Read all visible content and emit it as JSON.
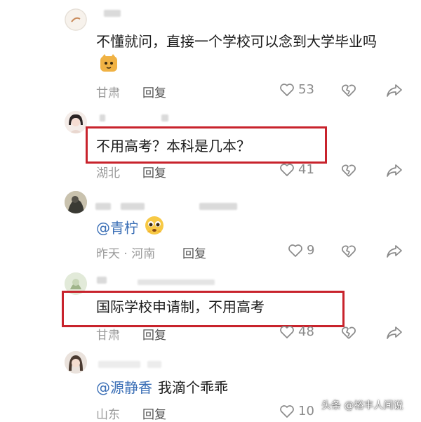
{
  "comments": [
    {
      "text": "不懂就问，直接一个学校可以念到大学毕业吗",
      "location": "甘肃",
      "reply_label": "回复",
      "likes": "53",
      "emoji": "cat-face"
    },
    {
      "text": "不用高考？本科是几本？",
      "location": "湖北",
      "reply_label": "回复",
      "likes": "41"
    },
    {
      "mention": "@青柠",
      "location": "昨天 · 河南",
      "reply_label": "回复",
      "likes": "9",
      "emoji": "pleading-face"
    },
    {
      "text": "国际学校申请制，不用高考",
      "location": "甘肃",
      "reply_label": "回复",
      "likes": "48"
    },
    {
      "mention": "@源静香",
      "text": "我滴个乖乖",
      "location": "山东",
      "reply_label": "回复",
      "likes": "10"
    }
  ],
  "watermark": "头条 @裕丰人间说",
  "colors": {
    "highlight": "#c8232c",
    "mention": "#3b6fb6",
    "meta_text": "#9a9a9a"
  },
  "icons": [
    "heart-outline-icon",
    "broken-heart-icon",
    "share-arrow-icon"
  ]
}
